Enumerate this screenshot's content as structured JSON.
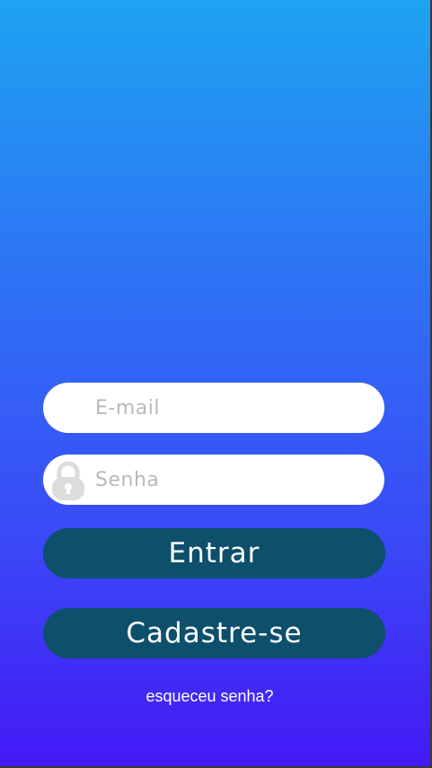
{
  "form": {
    "email": {
      "placeholder": "E-mail",
      "value": ""
    },
    "password": {
      "placeholder": "Senha",
      "value": "",
      "icon": "lock-icon"
    }
  },
  "buttons": {
    "login_label": "Entrar",
    "signup_label": "Cadastre-se"
  },
  "links": {
    "forgot_password": "esqueceu senha?"
  },
  "colors": {
    "gradient_top": "#1ea3f1",
    "gradient_bottom": "#4419f6",
    "button_bg": "#0e4f6c",
    "field_bg": "#ffffff",
    "placeholder": "#b9b9b9"
  }
}
